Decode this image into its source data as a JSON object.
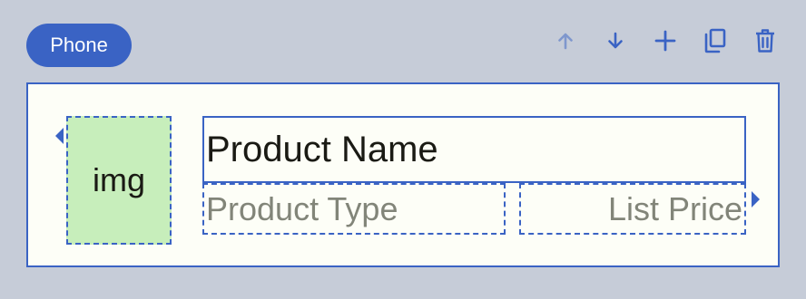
{
  "chip": {
    "label": "Phone"
  },
  "toolbar": {
    "items": [
      {
        "icon": "arrow-up-icon",
        "enabled": false
      },
      {
        "icon": "arrow-down-icon",
        "enabled": true
      },
      {
        "icon": "plus-icon",
        "enabled": true
      },
      {
        "icon": "copy-icon",
        "enabled": true
      },
      {
        "icon": "trash-icon",
        "enabled": true
      }
    ]
  },
  "card": {
    "image_label": "img",
    "name_label": "Product Name",
    "type_label": "Product Type",
    "price_label": "List Price"
  },
  "colors": {
    "accent": "#3a63c4",
    "background": "#c6ccd8",
    "card_background": "#fdfef7",
    "image_fill": "#c7eebb",
    "placeholder_text": "#828579",
    "text": "#1a1a14"
  }
}
